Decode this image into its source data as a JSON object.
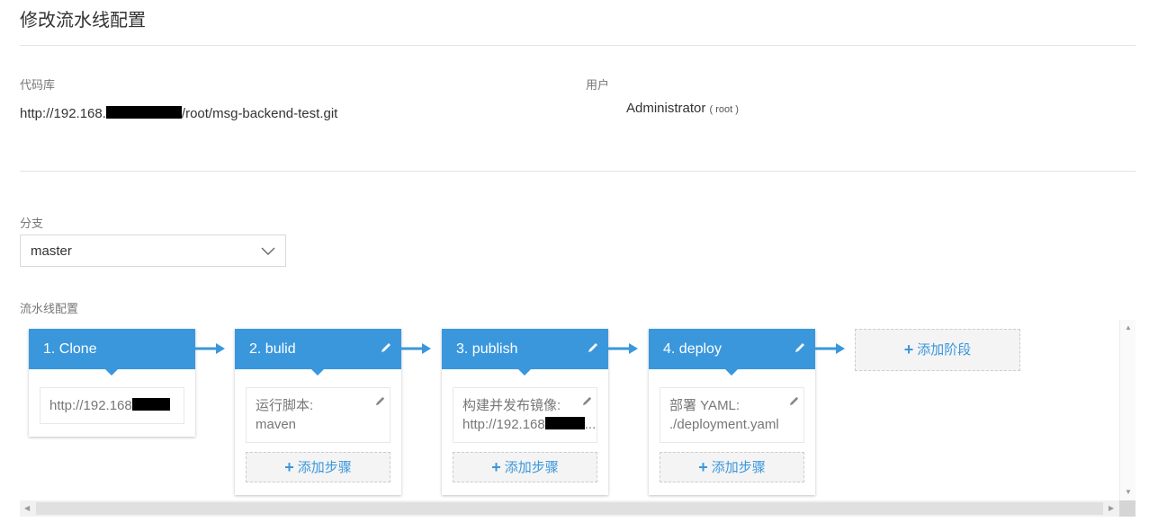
{
  "page": {
    "title": "修改流水线配置"
  },
  "repo": {
    "label": "代码库",
    "url_prefix": "http://192.168.",
    "url_suffix": "/root/msg-backend-test.git"
  },
  "user": {
    "label": "用户",
    "name": "Administrator",
    "username": "( root )"
  },
  "branch": {
    "label": "分支",
    "value": "master"
  },
  "pipeline": {
    "label": "流水线配置",
    "stages": [
      {
        "title": "1. Clone",
        "steps": [
          {
            "line1": "http://192.168",
            "line2": ""
          }
        ]
      },
      {
        "title": "2. bulid",
        "steps": [
          {
            "line1": "运行脚本:",
            "line2": "maven"
          }
        ],
        "add_step": "添加步骤"
      },
      {
        "title": "3. publish",
        "steps": [
          {
            "line1": "构建并发布镜像:",
            "line2": "http://192.168"
          }
        ],
        "add_step": "添加步骤"
      },
      {
        "title": "4. deploy",
        "steps": [
          {
            "line1": "部署 YAML:",
            "line2": "./deployment.yaml"
          }
        ],
        "add_step": "添加步骤"
      }
    ],
    "add_stage": "添加阶段",
    "ellipsis": "..."
  },
  "colors": {
    "accent": "#3a97dc",
    "divider": "#e5e5e5",
    "redaction": "#000000"
  },
  "icons": {
    "edit": "pencil-icon",
    "dropdown": "chevron-down-icon",
    "add": "plus-icon",
    "connector": "arrow-right-icon"
  }
}
